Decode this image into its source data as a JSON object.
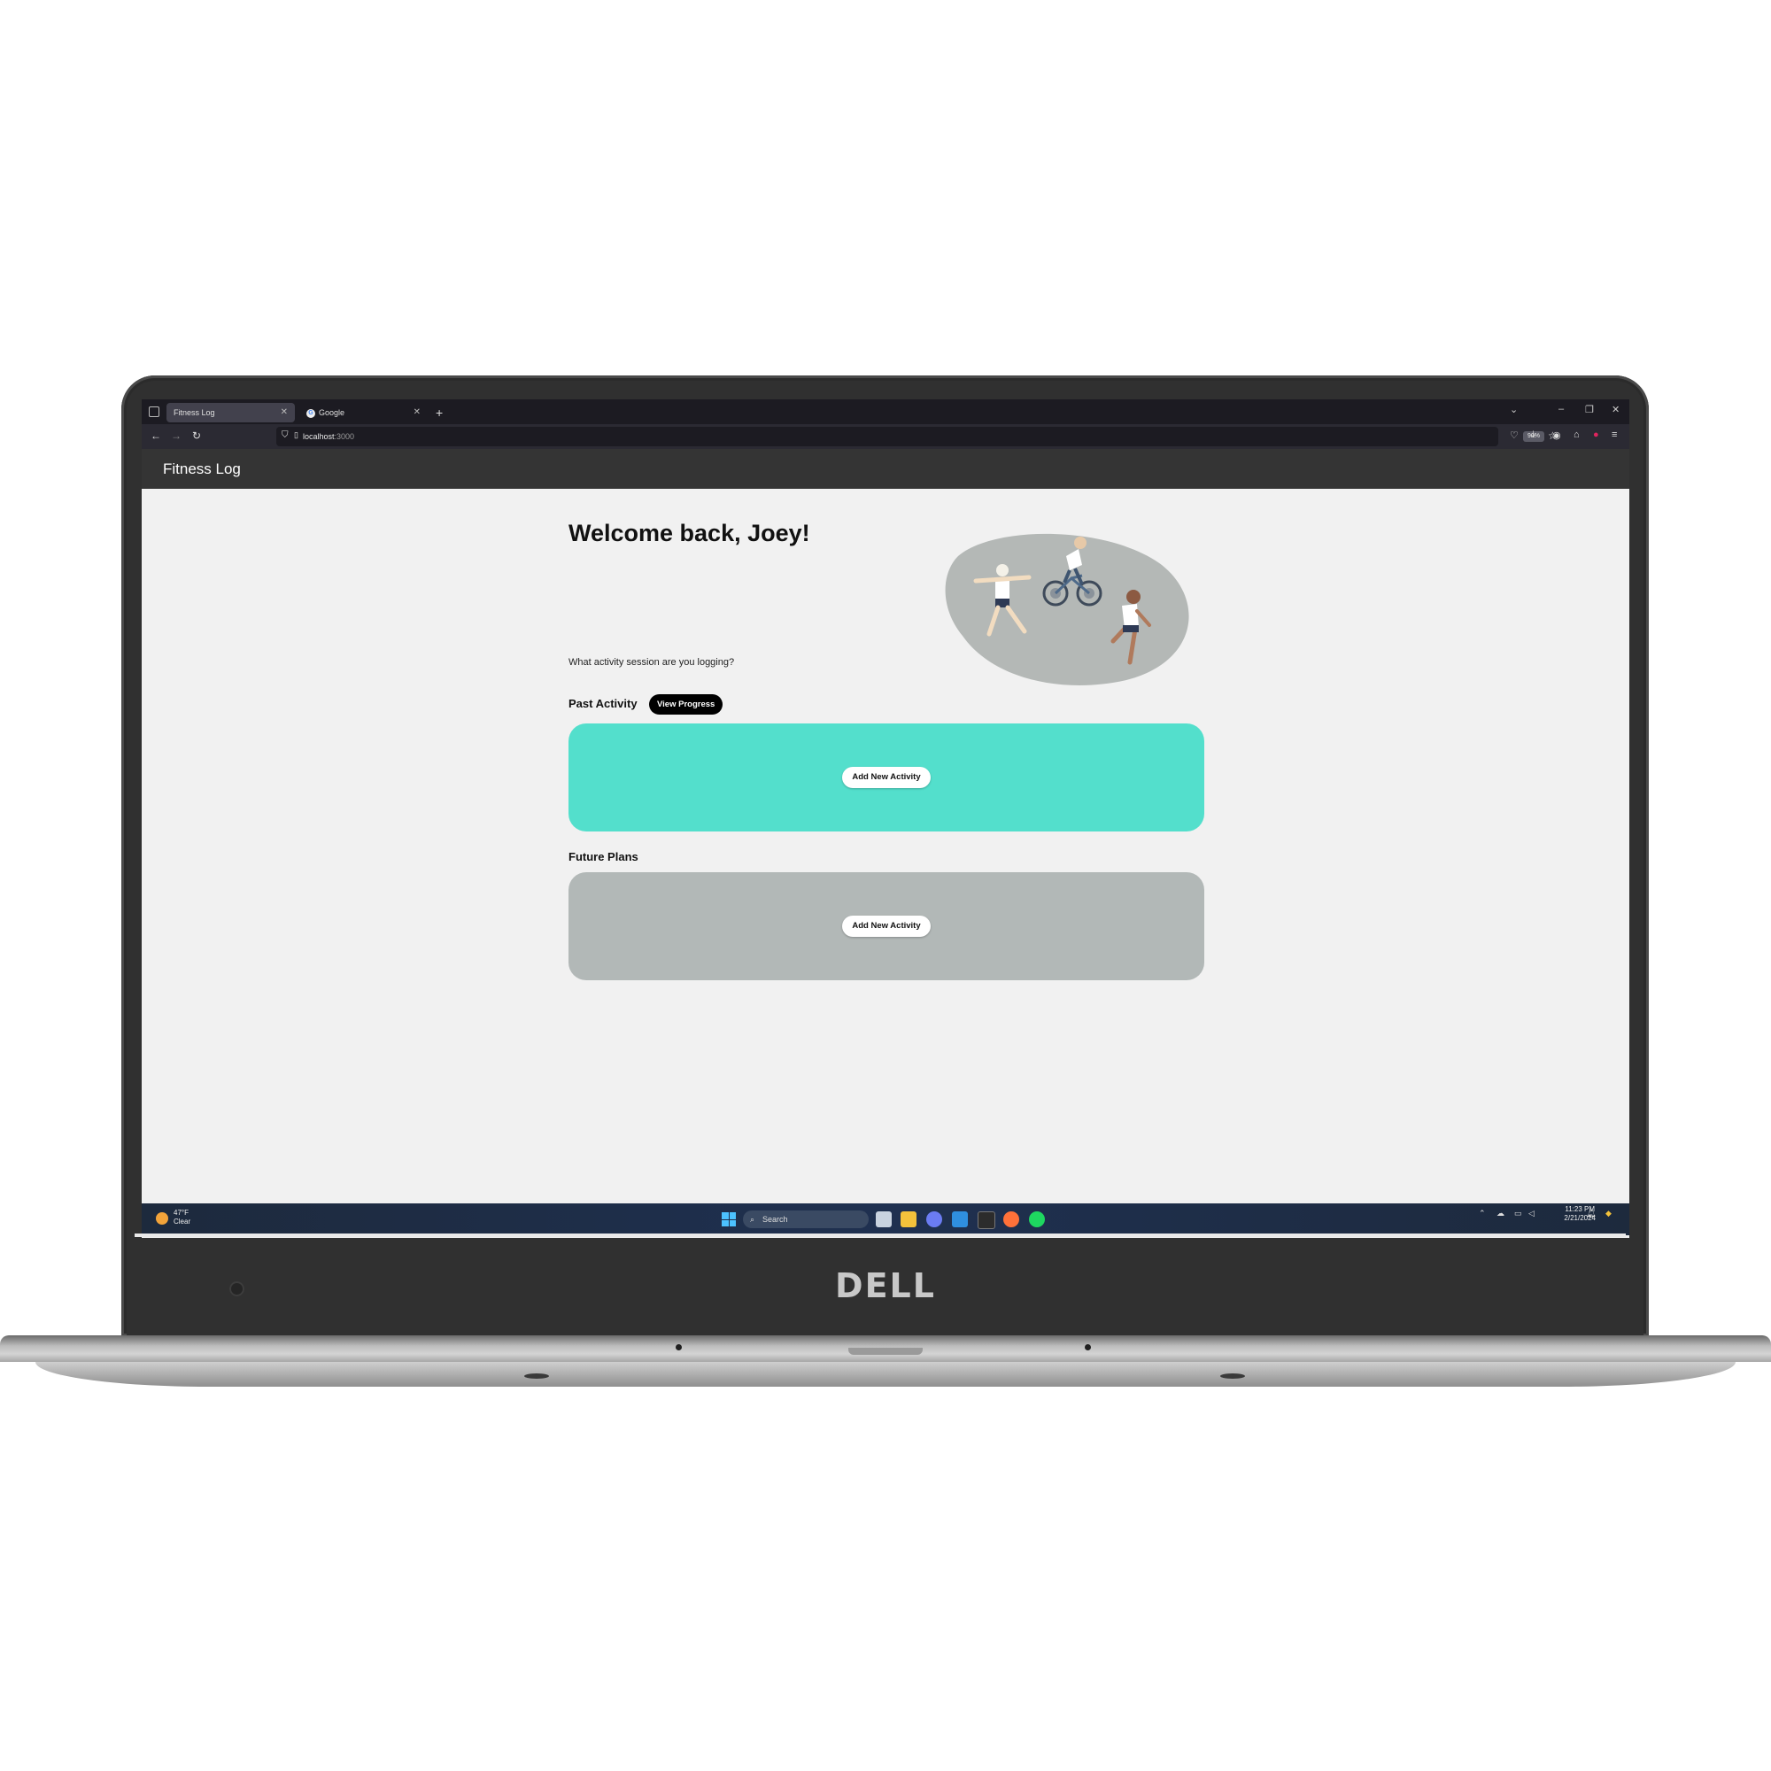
{
  "device": {
    "brand_logo": "DELL"
  },
  "browser": {
    "tabs": [
      {
        "label": "Fitness Log",
        "active": true
      },
      {
        "label": "Google",
        "active": false
      }
    ],
    "url": {
      "host": "localhost",
      "port": ":3000"
    },
    "zoom": "90%"
  },
  "app": {
    "title": "Fitness Log",
    "welcome": "Welcome back, Joey!",
    "prompt": "What activity session are you logging?",
    "past_activity": {
      "label": "Past Activity",
      "view_progress_label": "View Progress",
      "add_label": "Add New Activity",
      "color": "#53dfcc"
    },
    "future_plans": {
      "label": "Future Plans",
      "add_label": "Add New Activity",
      "color": "#b2b8b7"
    }
  },
  "taskbar": {
    "weather_temp": "47°F",
    "weather_desc": "Clear",
    "search_label": "Search",
    "time": "11:23 PM",
    "date": "2/21/2024"
  }
}
